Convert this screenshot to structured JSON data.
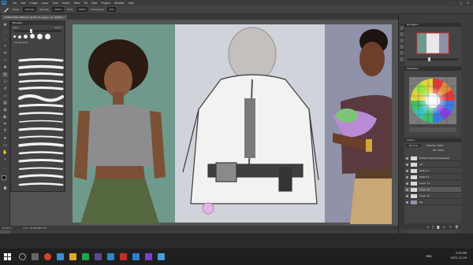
{
  "app": {
    "logo_text": "Ps",
    "menu": [
      "File",
      "Edit",
      "Image",
      "Layer",
      "Type",
      "Select",
      "Filter",
      "3D",
      "View",
      "Plugins",
      "Window",
      "Help"
    ]
  },
  "options_bar": {
    "mode_label": "Mode:",
    "mode_value": "Normal",
    "opacity_label": "Opacity:",
    "opacity_value": "100%",
    "flow_label": "Flow:",
    "flow_value": "100%",
    "smoothing_label": "Smoothing:",
    "smoothing_value": "0%"
  },
  "document": {
    "tab_title": "CHARE EMIL NEW.psd @ 66.7% (Layer 12, RGB/8) *"
  },
  "brush_panel": {
    "title": "Brushes",
    "size_label": "Size:",
    "size_value": "45 px",
    "folder_label": "My Brushes"
  },
  "status": {
    "zoom": "66.67%",
    "doc_info": "Doc: 48.9M/388.7M"
  },
  "panels": {
    "navigator_title": "Navigator",
    "swatches_title": "Swatches",
    "layers_title": "Layers",
    "blend_mode": "Normal",
    "opacity_label": "Opacity:",
    "opacity_value": "100%",
    "fill_label": "Fill:",
    "fill_value": "100%",
    "layers": [
      {
        "name": "Default (symbols/shapes)",
        "active": false
      },
      {
        "name": "ref",
        "active": false
      },
      {
        "name": "sketch 2",
        "active": false
      },
      {
        "name": "sketch 1",
        "active": false
      },
      {
        "name": "Layer 11",
        "active": false
      },
      {
        "name": "Layer 12",
        "active": true
      },
      {
        "name": "Layer 10",
        "active": false
      },
      {
        "name": "bg",
        "active": false
      }
    ]
  },
  "taskbar": {
    "language": "ENG",
    "time": "2:55 PM",
    "date": "2021-11-24"
  },
  "colors": {
    "accent_blue": "#2a85c7",
    "app_bg": "#535353",
    "panel_bg": "#434343",
    "art_teal": "#6e998c",
    "art_gray": "#d0d4da",
    "art_purple": "#8f92a8"
  }
}
